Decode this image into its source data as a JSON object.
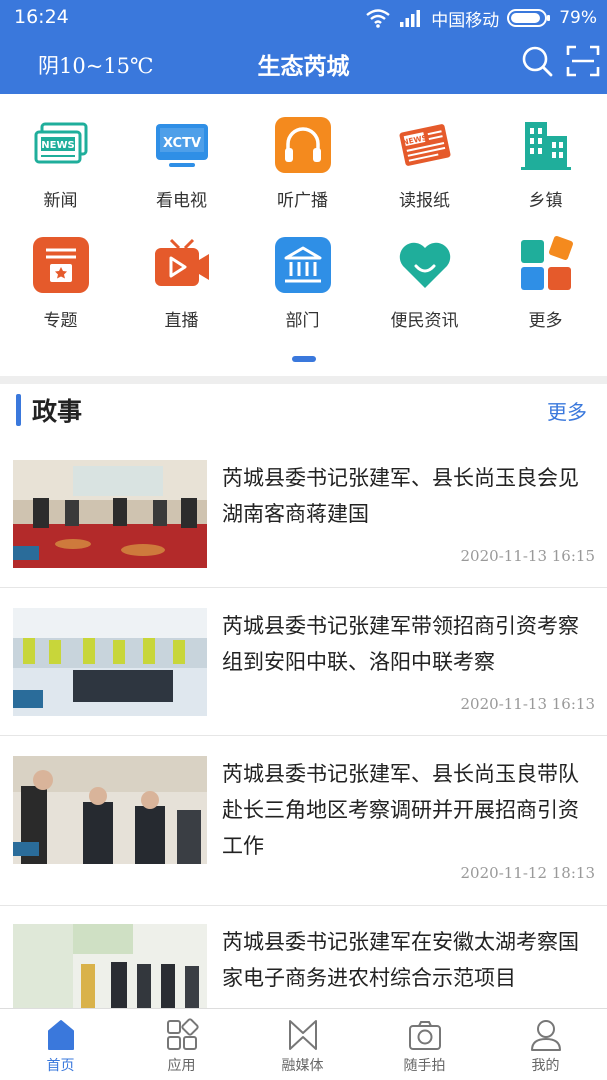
{
  "status_bar": {
    "time": "16:24",
    "carrier": "中国移动",
    "battery": "79%"
  },
  "header": {
    "weather": "阴10~15℃",
    "title": "生态芮城",
    "icons": [
      "search-icon",
      "scan-icon"
    ]
  },
  "quick_grid": [
    {
      "label": "新闻",
      "icon": "news-icon"
    },
    {
      "label": "看电视",
      "icon": "tv-icon"
    },
    {
      "label": "听广播",
      "icon": "headphones-icon"
    },
    {
      "label": "读报纸",
      "icon": "newspaper-icon"
    },
    {
      "label": "乡镇",
      "icon": "building-icon"
    },
    {
      "label": "专题",
      "icon": "topic-icon"
    },
    {
      "label": "直播",
      "icon": "live-icon"
    },
    {
      "label": "部门",
      "icon": "department-icon"
    },
    {
      "label": "便民资讯",
      "icon": "heart-icon"
    },
    {
      "label": "更多",
      "icon": "more-apps-icon"
    }
  ],
  "section": {
    "title": "政事",
    "more": "更多"
  },
  "news": [
    {
      "title": "芮城县委书记张建军、县长尚玉良会见湖南客商蒋建国",
      "date": "2020-11-13 16:15"
    },
    {
      "title": "芮城县委书记张建军带领招商引资考察组到安阳中联、洛阳中联考察",
      "date": "2020-11-13 16:13"
    },
    {
      "title": "芮城县委书记张建军、县长尚玉良带队赴长三角地区考察调研并开展招商引资工作",
      "date": "2020-11-12 18:13"
    },
    {
      "title": "芮城县委书记张建军在安徽太湖考察国家电子商务进农村综合示范项目",
      "date": ""
    }
  ],
  "bottom_nav": [
    {
      "label": "首页",
      "icon": "home-icon",
      "active": true
    },
    {
      "label": "应用",
      "icon": "apps-icon",
      "active": false
    },
    {
      "label": "融媒体",
      "icon": "media-icon",
      "active": false
    },
    {
      "label": "随手拍",
      "icon": "camera-icon",
      "active": false
    },
    {
      "label": "我的",
      "icon": "profile-icon",
      "active": false
    }
  ],
  "colors": {
    "brand": "#3a78dc",
    "news_icon": "#1fae9b",
    "orange": "#f48a1e",
    "red_orange": "#e55a2b"
  }
}
